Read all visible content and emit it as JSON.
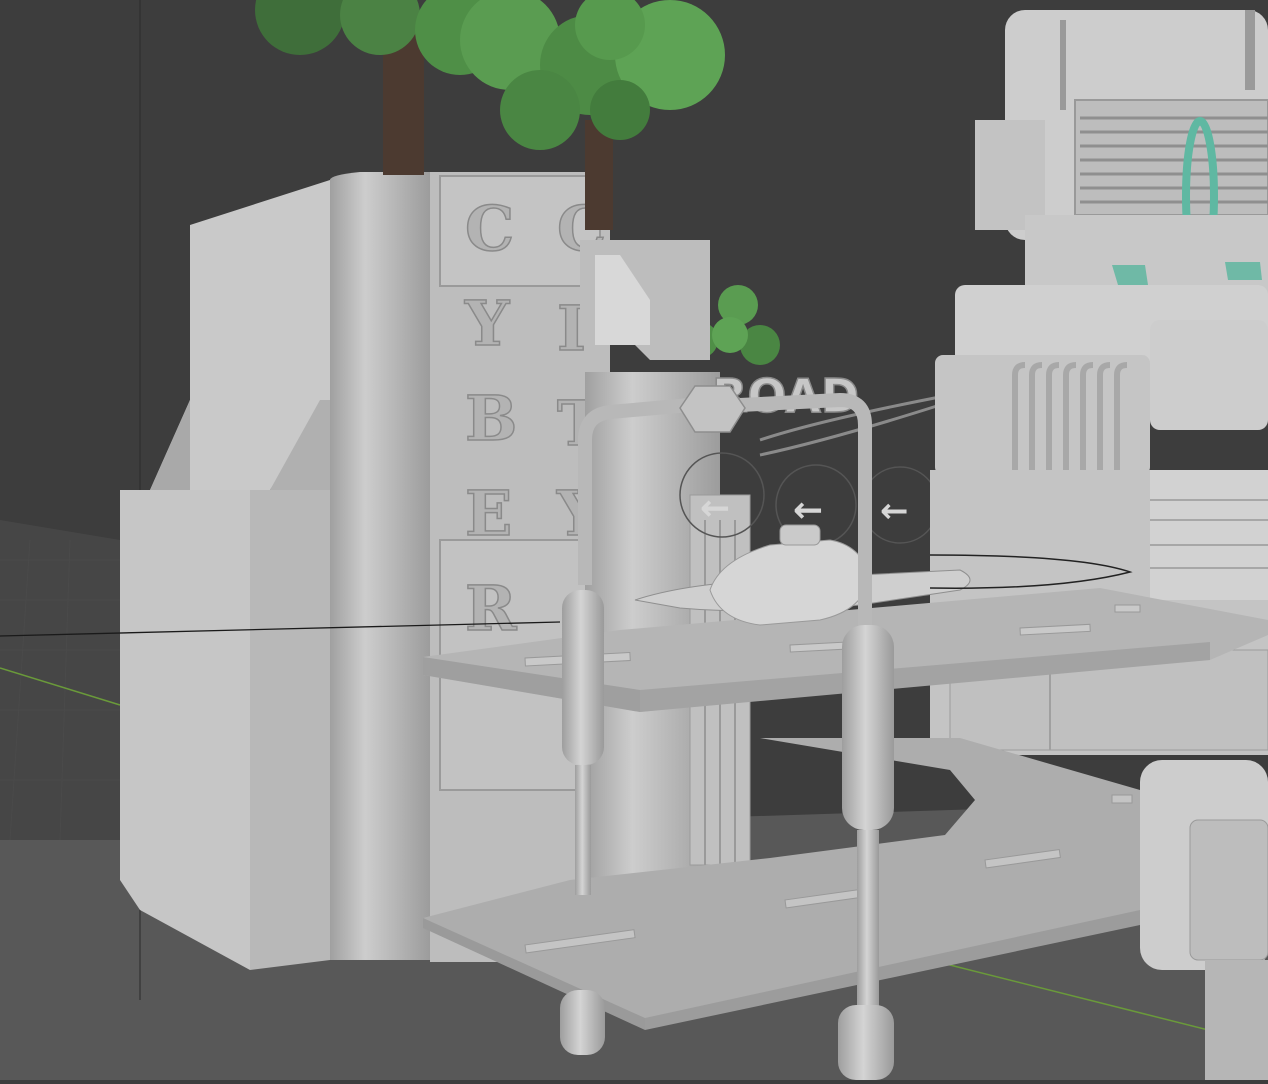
{
  "scene": {
    "tower_column_1": [
      "C",
      "Y",
      "B",
      "E",
      "R"
    ],
    "tower_column_2": [
      "C",
      "I",
      "T",
      "Y"
    ],
    "road_sign": "ROAD",
    "arrow_signs": [
      "←",
      "←",
      "←"
    ]
  },
  "palette": {
    "background": "#3d3d3d",
    "floor": "#565656",
    "building_light": "#c9c9c9",
    "building_mid": "#b2b2b2",
    "building_dark": "#8f8f8f",
    "foliage": "#4f8f47",
    "trunk": "#4c3a30",
    "accent_teal": "#5fb8a2",
    "grid_green": "#6a9a3a"
  }
}
